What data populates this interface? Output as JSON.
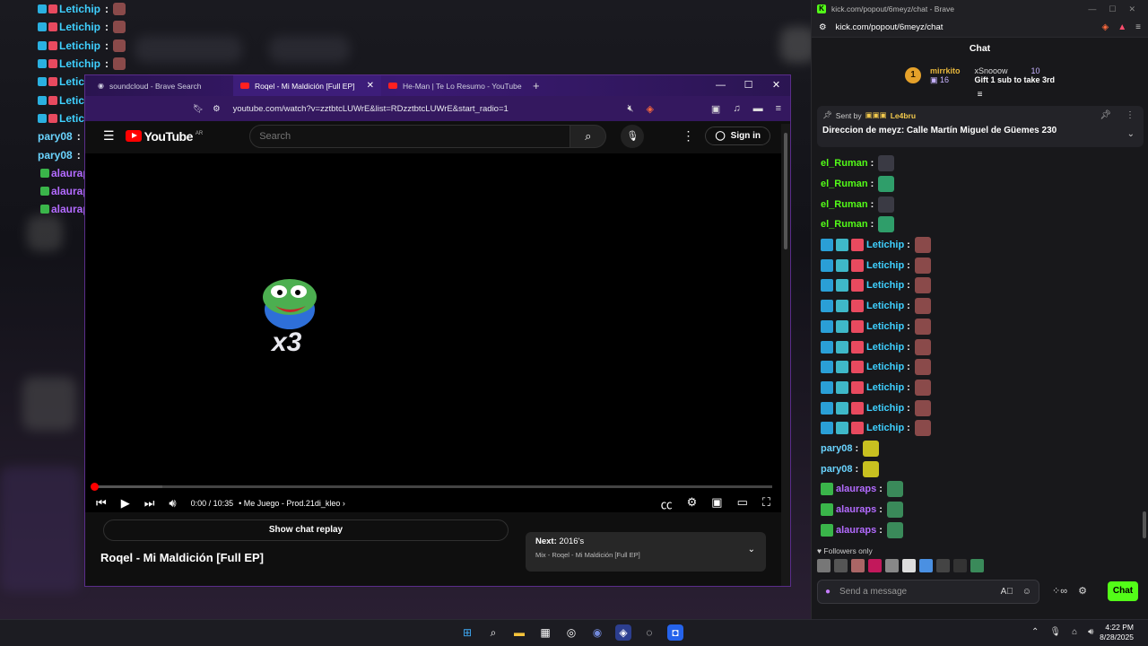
{
  "overlay_chat": [
    {
      "user": "Letichip",
      "sep": ":",
      "color": "#3fd0ff",
      "badges": [
        "#2ab0e0",
        "#e84a5f"
      ],
      "emote": "#8a4a4a"
    },
    {
      "user": "Letichip",
      "sep": ":",
      "color": "#3fd0ff",
      "badges": [
        "#2ab0e0",
        "#e84a5f"
      ],
      "emote": "#8a4a4a"
    },
    {
      "user": "Letichip",
      "sep": ":",
      "color": "#3fd0ff",
      "badges": [
        "#2ab0e0",
        "#e84a5f"
      ],
      "emote": "#8a4a4a"
    },
    {
      "user": "Letichip",
      "sep": ":",
      "color": "#3fd0ff",
      "badges": [
        "#2ab0e0",
        "#e84a5f"
      ],
      "emote": "#8a4a4a"
    },
    {
      "user": "Letichip",
      "sep": ":",
      "color": "#3fd0ff",
      "badges": [
        "#2ab0e0",
        "#e84a5f"
      ],
      "emote": "#8a4a4a"
    },
    {
      "user": "Letichip",
      "sep": ":",
      "color": "#3fd0ff",
      "badges": [
        "#2ab0e0",
        "#e84a5f"
      ],
      "emote": "#8a4a4a"
    },
    {
      "user": "Letichip",
      "sep": ":",
      "color": "#3fd0ff",
      "badges": [
        "#2ab0e0",
        "#e84a5f"
      ],
      "emote": "#8a4a4a"
    },
    {
      "user": "pary08",
      "sep": ":",
      "color": "#6ad4ff",
      "badges": [],
      "emote": "#c8c020"
    },
    {
      "user": "pary08",
      "sep": ":",
      "color": "#6ad4ff",
      "badges": [],
      "emote": "#c8c020"
    },
    {
      "user": "alauraps",
      "sep": ":",
      "color": "#b36bff",
      "badges": [
        "#3ab54a"
      ],
      "emote": "#3a8a5a"
    },
    {
      "user": "alauraps",
      "sep": ":",
      "color": "#b36bff",
      "badges": [
        "#3ab54a"
      ],
      "emote": "#3a8a5a"
    },
    {
      "user": "alauraps",
      "sep": ":",
      "color": "#b36bff",
      "badges": [
        "#3ab54a"
      ],
      "emote": "#3a8a5a"
    }
  ],
  "yt_window": {
    "tabs": [
      {
        "label": "soundcloud - Brave Search",
        "active": false
      },
      {
        "label": "Roqel - Mi Maldición [Full EP] - Y",
        "active": true
      },
      {
        "label": "He-Man | Te Lo Resumo - YouTube",
        "active": false
      }
    ],
    "new_tab": "+",
    "url": "youtube.com/watch?v=zztbtcLUWrE&list=RDzztbtcLUWrE&start_radio=1",
    "logo": "YouTube",
    "region": "AR",
    "search_placeholder": "Search",
    "sign_in": "Sign in",
    "overlay_text": "x3",
    "time": "0:00 / 10:35",
    "chapter": "• Me Juego - Prod.21di_kleo ›",
    "progress": 0.0,
    "show_chat_replay": "Show chat replay",
    "next_label": "Next:",
    "next_title": "2016's",
    "next_sub": "Mix - Roqel - Mi Maldición [Full EP]",
    "video_title": "Roqel - Mi Maldición [Full EP]"
  },
  "kick_window": {
    "title": "kick.com/popout/6meyz/chat - Brave",
    "url": "kick.com/popout/6meyz/chat",
    "chat_header": "Chat",
    "leaderboard": {
      "rank": "1",
      "top_name": "mirrkito",
      "top_count": "16",
      "second_name": "xSnooow",
      "second_count": "10",
      "gift_text": "Gift 1 sub to take 3rd"
    },
    "pinned": {
      "sent_by_label": "Sent by",
      "sender": "Le4bru",
      "message": "Direccion de meyz: Calle Martín Miguel de Güemes 230"
    },
    "messages": [
      {
        "user": "el_Ruman",
        "color": "#53fc18",
        "badges": [],
        "emote": "#3a3a44"
      },
      {
        "user": "el_Ruman",
        "color": "#53fc18",
        "badges": [],
        "emote": "#2f9e6a"
      },
      {
        "user": "el_Ruman",
        "color": "#53fc18",
        "badges": [],
        "emote": "#3a3a44"
      },
      {
        "user": "el_Ruman",
        "color": "#53fc18",
        "badges": [],
        "emote": "#2f9e6a"
      },
      {
        "user": "Letichip",
        "color": "#3fd0ff",
        "badges": [
          "#2a9fd6",
          "#3fb8c8",
          "#e84a5f"
        ],
        "emote": "#8a4a4a"
      },
      {
        "user": "Letichip",
        "color": "#3fd0ff",
        "badges": [
          "#2a9fd6",
          "#3fb8c8",
          "#e84a5f"
        ],
        "emote": "#8a4a4a"
      },
      {
        "user": "Letichip",
        "color": "#3fd0ff",
        "badges": [
          "#2a9fd6",
          "#3fb8c8",
          "#e84a5f"
        ],
        "emote": "#8a4a4a"
      },
      {
        "user": "Letichip",
        "color": "#3fd0ff",
        "badges": [
          "#2a9fd6",
          "#3fb8c8",
          "#e84a5f"
        ],
        "emote": "#8a4a4a"
      },
      {
        "user": "Letichip",
        "color": "#3fd0ff",
        "badges": [
          "#2a9fd6",
          "#3fb8c8",
          "#e84a5f"
        ],
        "emote": "#8a4a4a"
      },
      {
        "user": "Letichip",
        "color": "#3fd0ff",
        "badges": [
          "#2a9fd6",
          "#3fb8c8",
          "#e84a5f"
        ],
        "emote": "#8a4a4a"
      },
      {
        "user": "Letichip",
        "color": "#3fd0ff",
        "badges": [
          "#2a9fd6",
          "#3fb8c8",
          "#e84a5f"
        ],
        "emote": "#8a4a4a"
      },
      {
        "user": "Letichip",
        "color": "#3fd0ff",
        "badges": [
          "#2a9fd6",
          "#3fb8c8",
          "#e84a5f"
        ],
        "emote": "#8a4a4a"
      },
      {
        "user": "Letichip",
        "color": "#3fd0ff",
        "badges": [
          "#2a9fd6",
          "#3fb8c8",
          "#e84a5f"
        ],
        "emote": "#8a4a4a"
      },
      {
        "user": "Letichip",
        "color": "#3fd0ff",
        "badges": [
          "#2a9fd6",
          "#3fb8c8",
          "#e84a5f"
        ],
        "emote": "#8a4a4a"
      },
      {
        "user": "pary08",
        "color": "#6ad4ff",
        "badges": [],
        "emote": "#c8c020"
      },
      {
        "user": "pary08",
        "color": "#6ad4ff",
        "badges": [],
        "emote": "#c8c020"
      },
      {
        "user": "alauraps",
        "color": "#b36bff",
        "badges": [
          "#3ab54a"
        ],
        "emote": "#3a8a5a"
      },
      {
        "user": "alauraps",
        "color": "#b36bff",
        "badges": [
          "#3ab54a"
        ],
        "emote": "#3a8a5a"
      },
      {
        "user": "alauraps",
        "color": "#b36bff",
        "badges": [
          "#3ab54a"
        ],
        "emote": "#3a8a5a"
      }
    ],
    "followers_only": "Followers only",
    "emote_bar": [
      "#777",
      "#555",
      "#a66",
      "#c2185b",
      "#888",
      "#ddd",
      "#4a90e2",
      "#444",
      "#333",
      "#3a8a5a"
    ],
    "input_placeholder": "Send a message",
    "chat_button": "Chat"
  },
  "taskbar": {
    "time": "4:22 PM",
    "date": "8/28/2025"
  }
}
